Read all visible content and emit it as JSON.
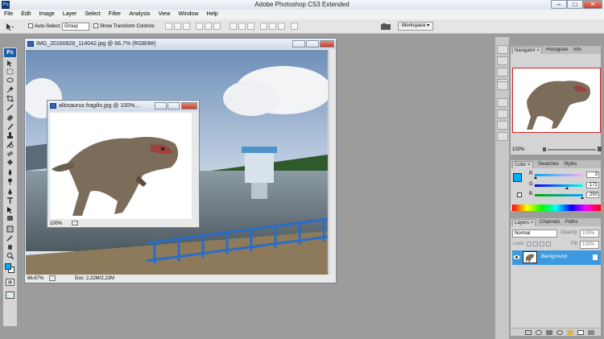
{
  "window": {
    "app_badge": "Ps",
    "title": "Adobe Photoshop CS3 Extended",
    "min_glyph": "–",
    "max_glyph": "□",
    "close_glyph": "✕"
  },
  "menu": [
    "File",
    "Edit",
    "Image",
    "Layer",
    "Select",
    "Filter",
    "Analysis",
    "View",
    "Window",
    "Help"
  ],
  "options": {
    "auto_select_label": "Auto-Select:",
    "auto_select_value": "Group",
    "transform_label": "Show Transform Controls",
    "workspace_label": "Workspace ▾"
  },
  "doc_main": {
    "title": "IMG_20160828_114042.jpg @ 66,7% (RGB/8#)",
    "zoom": "66,67%",
    "doc_info": "Doc: 2,22M/2,22M"
  },
  "doc_dino": {
    "title": "allosaurus fragilis.jpg @ 100%...",
    "zoom": "100%"
  },
  "navigator": {
    "tabs": [
      "Navigator ×",
      "Histogram",
      "Info"
    ],
    "zoom": "100%"
  },
  "color": {
    "tabs": [
      "Color ×",
      "Swatches",
      "Styles"
    ],
    "channels": [
      {
        "label": "R",
        "value": "3",
        "fraction": 0.01
      },
      {
        "label": "G",
        "value": "171",
        "fraction": 0.67
      },
      {
        "label": "B",
        "value": "250",
        "fraction": 0.98
      }
    ],
    "fg_color": "#03abfa"
  },
  "layers": {
    "tabs": [
      "Layers ×",
      "Channels",
      "Paths"
    ],
    "blend_mode": "Normal",
    "opacity_label": "Opacity:",
    "opacity_value": "100%",
    "lock_label": "Lock:",
    "fill_label": "Fill:",
    "fill_value": "100%",
    "items": [
      {
        "name": "Background",
        "selected": true
      }
    ]
  },
  "colors": {
    "selection": "#3d9ae0",
    "accent": "#1d5ca6"
  }
}
